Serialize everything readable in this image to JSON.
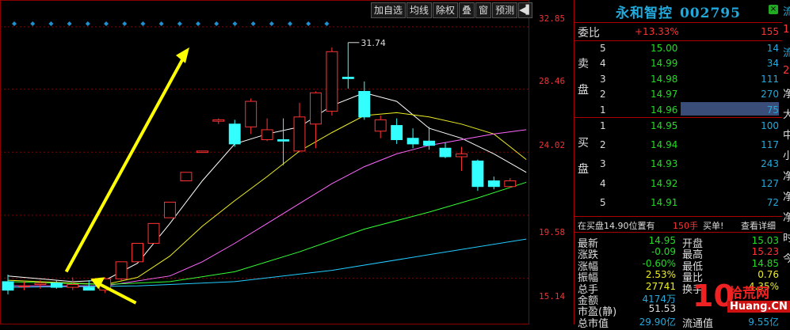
{
  "toolbar": {
    "buttons": [
      "加自选",
      "均线",
      "除权",
      "叠",
      "窗",
      "预测"
    ],
    "arrow_icon": "play-left-arrow"
  },
  "chart_data": {
    "type": "candlestick",
    "yaxis_ticks": [
      32.85,
      28.46,
      24.02,
      19.58,
      15.14
    ],
    "ylim": [
      13.0,
      33.4
    ],
    "peak_annotation": "31.74",
    "colors": {
      "up": "#ff3333",
      "down": "#33ffff",
      "grid": "#8a0000",
      "arrow": "#ffff00"
    },
    "candles": [
      {
        "o": 14.9,
        "h": 15.4,
        "l": 14.0,
        "c": 14.3
      },
      {
        "o": 14.6,
        "h": 14.9,
        "l": 14.3,
        "c": 14.6
      },
      {
        "o": 14.7,
        "h": 15.0,
        "l": 14.4,
        "c": 14.8
      },
      {
        "o": 14.8,
        "h": 15.0,
        "l": 14.4,
        "c": 14.5
      },
      {
        "o": 14.5,
        "h": 15.2,
        "l": 14.3,
        "c": 14.7
      },
      {
        "o": 14.5,
        "h": 15.0,
        "l": 14.3,
        "c": 14.3
      },
      {
        "o": 14.3,
        "h": 15.2,
        "l": 14.1,
        "c": 15.1
      },
      {
        "o": 15.1,
        "h": 16.3,
        "l": 15.0,
        "c": 16.3
      },
      {
        "o": 16.3,
        "h": 17.6,
        "l": 16.3,
        "c": 17.6
      },
      {
        "o": 17.6,
        "h": 19.0,
        "l": 17.6,
        "c": 19.0
      },
      {
        "o": 19.4,
        "h": 20.5,
        "l": 19.4,
        "c": 20.5
      },
      {
        "o": 22.0,
        "h": 22.6,
        "l": 22.0,
        "c": 22.6
      },
      {
        "o": 24.0,
        "h": 24.1,
        "l": 24.0,
        "c": 24.1
      },
      {
        "o": 26.2,
        "h": 26.4,
        "l": 26.0,
        "c": 26.3
      },
      {
        "o": 26.0,
        "h": 26.3,
        "l": 24.4,
        "c": 24.6
      },
      {
        "o": 25.8,
        "h": 27.8,
        "l": 25.3,
        "c": 27.6
      },
      {
        "o": 24.9,
        "h": 26.4,
        "l": 24.8,
        "c": 25.6
      },
      {
        "o": 24.9,
        "h": 26.4,
        "l": 23.1,
        "c": 24.8
      },
      {
        "o": 24.1,
        "h": 27.5,
        "l": 24.0,
        "c": 26.5
      },
      {
        "o": 26.0,
        "h": 28.3,
        "l": 24.3,
        "c": 28.2
      },
      {
        "o": 26.9,
        "h": 31.4,
        "l": 26.6,
        "c": 31.1
      },
      {
        "o": 29.3,
        "h": 31.74,
        "l": 28.5,
        "c": 29.2
      },
      {
        "o": 28.3,
        "h": 29.0,
        "l": 26.3,
        "c": 26.5
      },
      {
        "o": 25.5,
        "h": 26.6,
        "l": 25.0,
        "c": 26.3
      },
      {
        "o": 25.9,
        "h": 26.4,
        "l": 24.6,
        "c": 24.9
      },
      {
        "o": 25.0,
        "h": 25.7,
        "l": 24.3,
        "c": 24.6
      },
      {
        "o": 24.8,
        "h": 25.8,
        "l": 24.2,
        "c": 24.5
      },
      {
        "o": 24.3,
        "h": 24.7,
        "l": 23.6,
        "c": 23.7
      },
      {
        "o": 23.7,
        "h": 24.4,
        "l": 22.7,
        "c": 23.9
      },
      {
        "o": 23.4,
        "h": 23.5,
        "l": 21.3,
        "c": 21.6
      },
      {
        "o": 22.0,
        "h": 22.3,
        "l": 21.4,
        "c": 21.6
      },
      {
        "o": 21.6,
        "h": 22.2,
        "l": 21.5,
        "c": 22.0
      }
    ],
    "ma_lines": [
      {
        "name": "MA5",
        "color": "#ffffff",
        "values": [
          [
            0,
            15.3
          ],
          [
            4,
            14.9
          ],
          [
            6,
            15.0
          ],
          [
            8,
            16.2
          ],
          [
            10,
            19.0
          ],
          [
            12,
            22.0
          ],
          [
            14,
            24.6
          ],
          [
            16,
            25.3
          ],
          [
            18,
            25.8
          ],
          [
            20,
            27.3
          ],
          [
            22,
            28.2
          ],
          [
            24,
            27.6
          ],
          [
            26,
            25.7
          ],
          [
            28,
            25.0
          ],
          [
            30,
            23.9
          ],
          [
            32,
            22.6
          ]
        ]
      },
      {
        "name": "MA10",
        "color": "#eeee22",
        "values": [
          [
            0,
            15.0
          ],
          [
            6,
            14.7
          ],
          [
            8,
            15.2
          ],
          [
            10,
            16.7
          ],
          [
            12,
            18.8
          ],
          [
            14,
            20.6
          ],
          [
            16,
            22.3
          ],
          [
            18,
            24.1
          ],
          [
            20,
            25.4
          ],
          [
            22,
            26.6
          ],
          [
            24,
            26.8
          ],
          [
            26,
            26.5
          ],
          [
            28,
            26.0
          ],
          [
            30,
            25.3
          ],
          [
            32,
            23.5
          ]
        ]
      },
      {
        "name": "MA20",
        "color": "#ff66ff",
        "values": [
          [
            0,
            14.6
          ],
          [
            6,
            14.6
          ],
          [
            10,
            15.3
          ],
          [
            12,
            16.3
          ],
          [
            14,
            17.6
          ],
          [
            16,
            19.0
          ],
          [
            18,
            20.4
          ],
          [
            20,
            21.8
          ],
          [
            22,
            23.0
          ],
          [
            24,
            23.9
          ],
          [
            26,
            24.5
          ],
          [
            28,
            24.9
          ],
          [
            30,
            25.3
          ],
          [
            32,
            25.6
          ]
        ]
      },
      {
        "name": "MA30",
        "color": "#33ff33",
        "values": [
          [
            0,
            14.9
          ],
          [
            6,
            14.7
          ],
          [
            10,
            14.9
          ],
          [
            14,
            15.6
          ],
          [
            18,
            17.0
          ],
          [
            22,
            18.6
          ],
          [
            26,
            19.8
          ],
          [
            29,
            20.8
          ],
          [
            32,
            21.9
          ]
        ]
      },
      {
        "name": "MA60",
        "color": "#22ccff",
        "values": [
          [
            0,
            14.5
          ],
          [
            8,
            14.6
          ],
          [
            14,
            14.9
          ],
          [
            20,
            15.7
          ],
          [
            26,
            16.8
          ],
          [
            32,
            17.9
          ]
        ]
      }
    ]
  },
  "stock": {
    "name": "永和智控",
    "code": "002795"
  },
  "webi": {
    "label": "委比",
    "value": "+13.33%",
    "diff": "155"
  },
  "sell_label": [
    "卖",
    "盘"
  ],
  "buy_label": [
    "买",
    "盘"
  ],
  "sell": [
    {
      "level": "5",
      "price": "15.00",
      "vol": "14"
    },
    {
      "level": "4",
      "price": "14.99",
      "vol": "34"
    },
    {
      "level": "3",
      "price": "14.98",
      "vol": "111"
    },
    {
      "level": "2",
      "price": "14.97",
      "vol": "270"
    },
    {
      "level": "1",
      "price": "14.96",
      "vol": "75"
    }
  ],
  "buy": [
    {
      "level": "1",
      "price": "14.95",
      "vol": "100"
    },
    {
      "level": "2",
      "price": "14.94",
      "vol": "117"
    },
    {
      "level": "3",
      "price": "14.93",
      "vol": "243"
    },
    {
      "level": "4",
      "price": "14.92",
      "vol": "127"
    },
    {
      "level": "5",
      "price": "14.91",
      "vol": "72"
    }
  ],
  "info": {
    "text": "在买盘14.90位置有",
    "qty": "150手",
    "action": "买单!",
    "link": "查看详细"
  },
  "stats": [
    {
      "l1": "最新",
      "v1": "14.95",
      "c1": "g",
      "l2": "开盘",
      "v2": "15.03",
      "c2": "g"
    },
    {
      "l1": "涨跌",
      "v1": "-0.09",
      "c1": "g",
      "l2": "最高",
      "v2": "15.23",
      "c2": "r"
    },
    {
      "l1": "涨幅",
      "v1": "-0.60%",
      "c1": "g",
      "l2": "最低",
      "v2": "14.85",
      "c2": "g"
    },
    {
      "l1": "振幅",
      "v1": "2.53%",
      "c1": "y",
      "l2": "量比",
      "v2": "0.76",
      "c2": "y"
    },
    {
      "l1": "总手",
      "v1": "27741",
      "c1": "y",
      "l2": "换手",
      "v2": "4.35%",
      "c2": "y"
    },
    {
      "l1": "金额",
      "v1": "4174万",
      "c1": "c",
      "l2": "",
      "v2": "",
      "c2": "c"
    },
    {
      "l1": "市盈(静)",
      "v1": "51.53",
      "c1": "w",
      "l2": "",
      "v2": "",
      "c2": "w"
    },
    {
      "l1": "总市值",
      "v1": "29.90亿",
      "c1": "c",
      "l2": "流通值",
      "v2": "9.55亿",
      "c2": "c"
    }
  ],
  "far_column": [
    "流",
    "1!",
    "流",
    "2!",
    "净",
    "大",
    "中",
    "小",
    "净",
    "净",
    "净",
    "时",
    "今"
  ],
  "logo": {
    "big": "10",
    "top": "拾荒网",
    "bottom": "Huang.CN"
  }
}
